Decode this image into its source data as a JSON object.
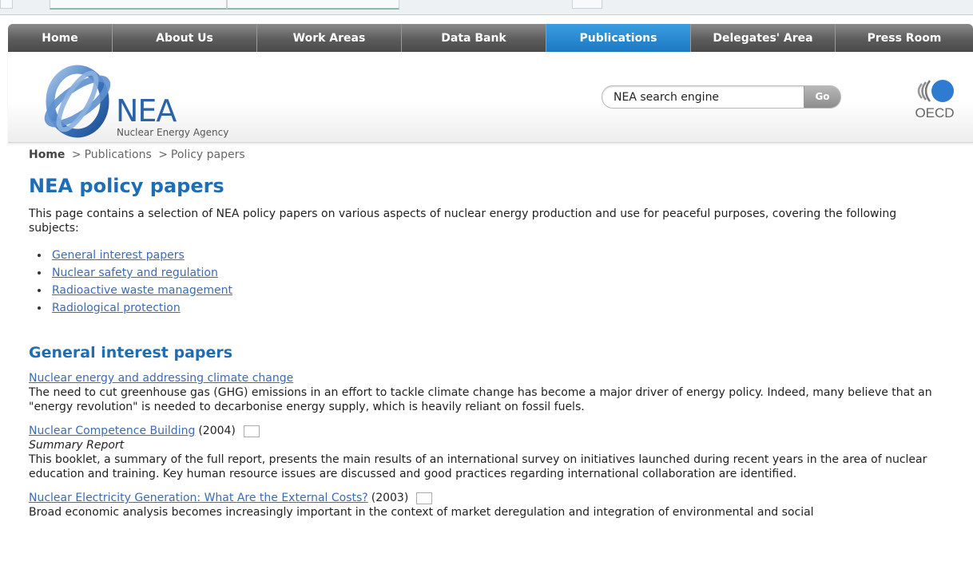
{
  "nav": {
    "items": [
      {
        "label": "Home",
        "width": 131,
        "active": false
      },
      {
        "label": "About Us",
        "width": 181,
        "active": false
      },
      {
        "label": "Work Areas",
        "width": 181,
        "active": false
      },
      {
        "label": "Data Bank",
        "width": 181,
        "active": false
      },
      {
        "label": "Publications",
        "width": 181,
        "active": true
      },
      {
        "label": "Delegates' Area",
        "width": 181,
        "active": false
      },
      {
        "label": "Press Room",
        "width": 172,
        "active": false
      }
    ],
    "active_color": "#1c78c2"
  },
  "logo": {
    "name": "NEA",
    "subtitle": "Nuclear Energy Agency",
    "oecd": "OECD"
  },
  "search": {
    "value": "NEA search engine",
    "go_label": "Go"
  },
  "breadcrumb": {
    "home": "Home",
    "separator": ">",
    "publications": "Publications",
    "current": "Policy papers"
  },
  "page": {
    "title": "NEA policy papers",
    "intro": "This page contains a selection of NEA policy papers on various aspects of nuclear energy production and use for peaceful purposes, covering the following subjects:",
    "subjects": [
      "General interest papers",
      "Nuclear safety and regulation",
      "Radioactive waste management",
      "Radiological protection"
    ]
  },
  "section": {
    "heading": "General interest papers",
    "papers": [
      {
        "title": "Nuclear energy and addressing climate change",
        "year": "",
        "subtitle": "",
        "description": "The need to cut greenhouse gas (GHG) emissions in an effort to tackle climate change has become a major driver of energy policy. Indeed, many believe that an \"energy revolution\" is needed to decarbonise energy supply, which is heavily reliant on fossil fuels."
      },
      {
        "title": "Nuclear Competence Building",
        "year": "(2004)",
        "subtitle": "Summary Report",
        "description": "This booklet, a summary of the full report, presents the main results of an international survey on initiatives launched during recent years in the area of nuclear education and training. Key human resource issues are discussed and good practices regarding international collaboration are identified."
      },
      {
        "title": "Nuclear Electricity Generation: What Are the External Costs?",
        "year": "(2003)",
        "subtitle": "",
        "description": "Broad economic analysis becomes increasingly important in the context of market deregulation and integration of environmental and social"
      }
    ]
  }
}
